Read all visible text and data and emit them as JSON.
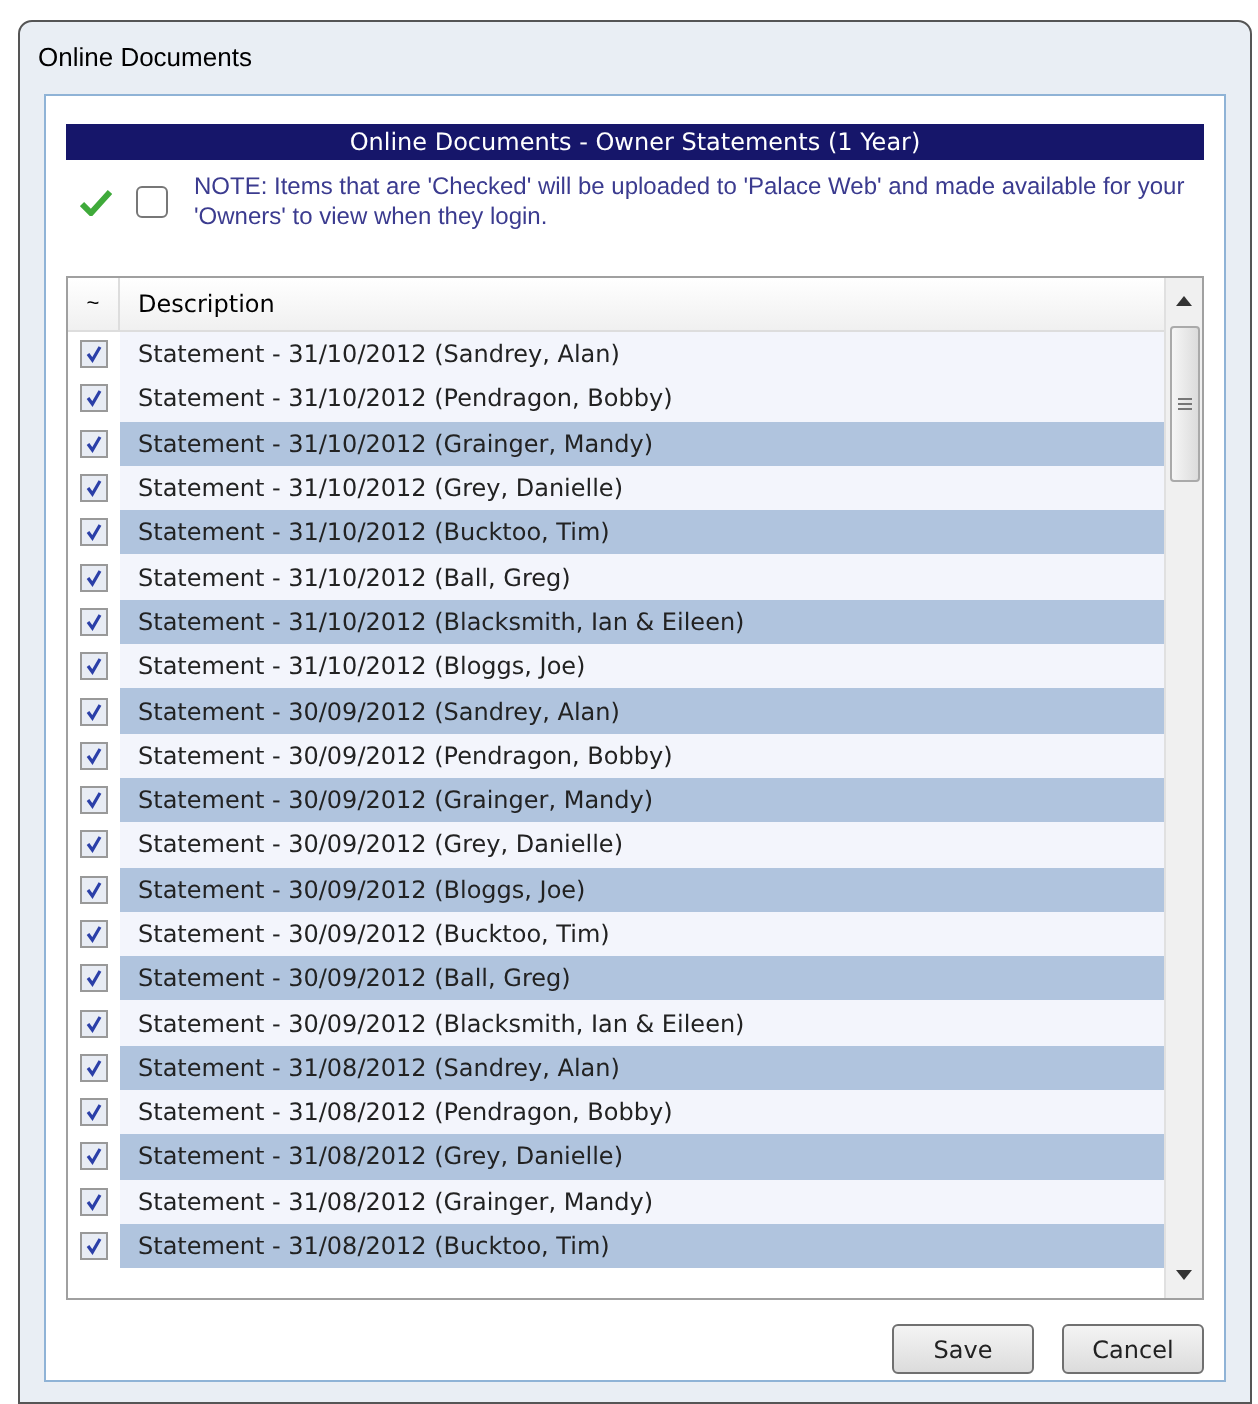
{
  "window": {
    "title": "Online Documents"
  },
  "banner": {
    "title": "Online Documents - Owner Statements (1 Year)"
  },
  "note": {
    "select_all_checked": false,
    "text": "NOTE: Items that are 'Checked' will be uploaded to 'Palace Web' and made available for your 'Owners' to view when they login."
  },
  "table": {
    "columns": [
      "~",
      "Description"
    ],
    "rows": [
      {
        "checked": true,
        "selected": false,
        "description": "Statement - 31/10/2012 (Sandrey, Alan)"
      },
      {
        "checked": true,
        "selected": false,
        "description": "Statement - 31/10/2012 (Pendragon, Bobby)"
      },
      {
        "checked": true,
        "selected": true,
        "description": "Statement - 31/10/2012 (Grainger, Mandy)"
      },
      {
        "checked": true,
        "selected": false,
        "description": "Statement - 31/10/2012 (Grey, Danielle)"
      },
      {
        "checked": true,
        "selected": true,
        "description": "Statement - 31/10/2012 (Bucktoo, Tim)"
      },
      {
        "checked": true,
        "selected": false,
        "description": "Statement - 31/10/2012 (Ball, Greg)"
      },
      {
        "checked": true,
        "selected": true,
        "description": "Statement - 31/10/2012 (Blacksmith, Ian & Eileen)"
      },
      {
        "checked": true,
        "selected": false,
        "description": "Statement - 31/10/2012 (Bloggs, Joe)"
      },
      {
        "checked": true,
        "selected": true,
        "description": "Statement - 30/09/2012 (Sandrey, Alan)"
      },
      {
        "checked": true,
        "selected": false,
        "description": "Statement - 30/09/2012 (Pendragon, Bobby)"
      },
      {
        "checked": true,
        "selected": true,
        "description": "Statement - 30/09/2012 (Grainger, Mandy)"
      },
      {
        "checked": true,
        "selected": false,
        "description": "Statement - 30/09/2012 (Grey, Danielle)"
      },
      {
        "checked": true,
        "selected": true,
        "description": "Statement - 30/09/2012 (Bloggs, Joe)"
      },
      {
        "checked": true,
        "selected": false,
        "description": "Statement - 30/09/2012 (Bucktoo, Tim)"
      },
      {
        "checked": true,
        "selected": true,
        "description": "Statement - 30/09/2012 (Ball, Greg)"
      },
      {
        "checked": true,
        "selected": false,
        "description": "Statement - 30/09/2012 (Blacksmith, Ian & Eileen)"
      },
      {
        "checked": true,
        "selected": true,
        "description": "Statement - 31/08/2012 (Sandrey, Alan)"
      },
      {
        "checked": true,
        "selected": false,
        "description": "Statement - 31/08/2012 (Pendragon, Bobby)"
      },
      {
        "checked": true,
        "selected": true,
        "description": "Statement - 31/08/2012 (Grey, Danielle)"
      },
      {
        "checked": true,
        "selected": false,
        "description": "Statement - 31/08/2012 (Grainger, Mandy)"
      },
      {
        "checked": true,
        "selected": true,
        "description": "Statement - 31/08/2012 (Bucktoo, Tim)"
      }
    ]
  },
  "buttons": [
    "Save",
    "Cancel"
  ]
}
